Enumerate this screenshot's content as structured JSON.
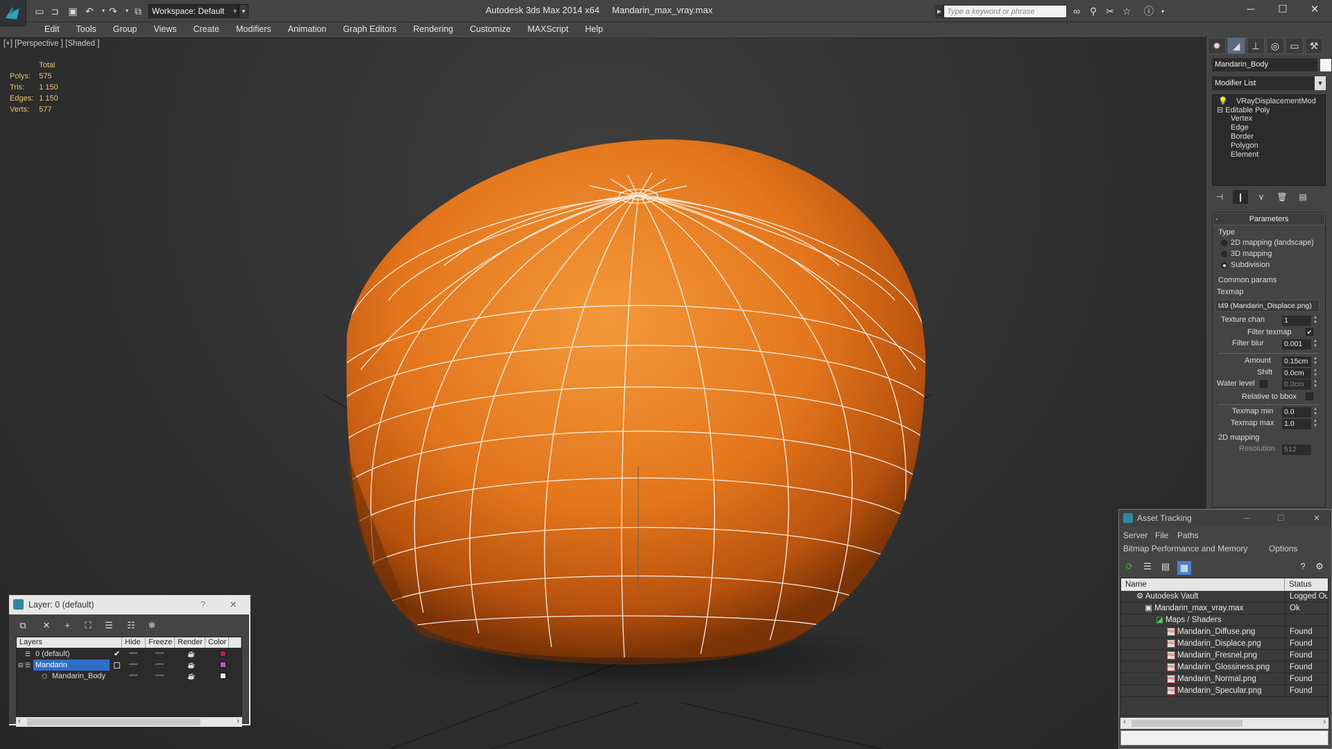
{
  "app": {
    "title": "Autodesk 3ds Max  2014 x64",
    "file": "Mandarin_max_vray.max",
    "workspace": "Workspace: Default",
    "search_placeholder": "Type a keyword or phrase"
  },
  "menu": [
    "Edit",
    "Tools",
    "Group",
    "Views",
    "Create",
    "Modifiers",
    "Animation",
    "Graph Editors",
    "Rendering",
    "Customize",
    "MAXScript",
    "Help"
  ],
  "viewport": {
    "label": "[+] [Perspective ] [Shaded ]",
    "stats": {
      "header": "Total",
      "polys_label": "Polys:",
      "polys": "575",
      "tris_label": "Tris:",
      "tris": "1 150",
      "edges_label": "Edges:",
      "edges": "1 150",
      "verts_label": "Verts:",
      "verts": "577"
    }
  },
  "command_panel": {
    "object_name": "Mandarin_Body",
    "modifier_list": "Modifier List",
    "stack": [
      "VRayDisplacementMod",
      "Editable Poly",
      "Vertex",
      "Edge",
      "Border",
      "Polygon",
      "Element"
    ],
    "params_title": "Parameters",
    "type_label": "Type",
    "type_options": [
      "2D mapping (landscape)",
      "3D mapping",
      "Subdivision"
    ],
    "type_selected": "Subdivision",
    "common_label": "Common params",
    "texmap_label": "Texmap",
    "texmap_value": "t49 (Mandarin_Displace.png)",
    "texture_chan_label": "Texture chan",
    "texture_chan": "1",
    "filter_texmap_label": "Filter texmap",
    "filter_blur_label": "Filter blur",
    "filter_blur": "0.001",
    "amount_label": "Amount",
    "amount": "0.15cm",
    "shift_label": "Shift",
    "shift": "0.0cm",
    "water_level_label": "Water level",
    "water_level": "0.0cm",
    "relative_bbox_label": "Relative to bbox",
    "texmap_min_label": "Texmap min",
    "texmap_min": "0.0",
    "texmap_max_label": "Texmap max",
    "texmap_max": "1.0",
    "mapping2d_label": "2D mapping",
    "resolution_label": "Resolution",
    "resolution": "512"
  },
  "layer_window": {
    "title": "Layer: 0 (default)",
    "help": "?",
    "close": "✕",
    "columns": [
      "Layers",
      "Hide",
      "Freeze",
      "Render",
      "Color"
    ],
    "rows": [
      {
        "name": "0 (default)",
        "color": "#c0194a"
      },
      {
        "name": "Mandarin",
        "color": "#c05ab0"
      },
      {
        "name": "Mandarin_Body",
        "color": "#e8e8e8"
      }
    ]
  },
  "asset_window": {
    "title": "Asset Tracking",
    "menu1": [
      "Server",
      "File",
      "Paths"
    ],
    "menu2": [
      "Bitmap Performance and Memory",
      "Options"
    ],
    "columns": [
      "Name",
      "Status"
    ],
    "rows": [
      {
        "name": "Autodesk Vault",
        "status": "Logged Out"
      },
      {
        "name": "Mandarin_max_vray.max",
        "status": "Ok"
      },
      {
        "name": "Maps / Shaders",
        "status": ""
      },
      {
        "name": "Mandarin_Diffuse.png",
        "status": "Found"
      },
      {
        "name": "Mandarin_Displace.png",
        "status": "Found"
      },
      {
        "name": "Mandarin_Fresnel.png",
        "status": "Found"
      },
      {
        "name": "Mandarin_Glossiness.png",
        "status": "Found"
      },
      {
        "name": "Mandarin_Normal.png",
        "status": "Found"
      },
      {
        "name": "Mandarin_Specular.png",
        "status": "Found"
      }
    ]
  },
  "colors": {
    "accent": "#2f6dc7",
    "fruit": "#e4761c",
    "stats": "#e6c66a"
  }
}
